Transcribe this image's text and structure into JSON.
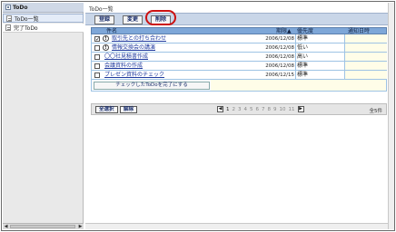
{
  "sidebar": {
    "header": "ToDo",
    "items": [
      {
        "label": "ToDo一覧"
      },
      {
        "label": "完了ToDo"
      }
    ]
  },
  "main": {
    "title": "ToDo一覧",
    "toolbar": {
      "register": "登録",
      "edit": "変更",
      "delete": "削除"
    },
    "columns": {
      "name": "件名",
      "deadline": "期限▲",
      "priority": "優先度",
      "notify": "通知日時"
    },
    "rows": [
      {
        "checked": "✓",
        "important": "!",
        "title": "取引先との打ち合わせ",
        "deadline": "2006/12/08",
        "priority": "標準"
      },
      {
        "checked": "",
        "important": "!",
        "title": "情報交換会の講演",
        "deadline": "2006/12/08",
        "priority": "低い"
      },
      {
        "checked": "",
        "important": "",
        "title": "〇〇社見積書作成",
        "deadline": "2006/12/08",
        "priority": "高い"
      },
      {
        "checked": "",
        "important": "",
        "title": "会議資料の作成",
        "deadline": "2006/12/08",
        "priority": "標準"
      },
      {
        "checked": "",
        "important": "",
        "title": "プレゼン資料のチェック",
        "deadline": "2006/12/15",
        "priority": "標準"
      }
    ],
    "complete_button": "チェックしたToDoを完了にする",
    "footer": {
      "select_all": "全選択",
      "deselect": "解除",
      "pages": [
        "1",
        "2",
        "3",
        "4",
        "5",
        "6",
        "7",
        "8",
        "9",
        "10",
        "11"
      ],
      "count": "全5件"
    }
  }
}
